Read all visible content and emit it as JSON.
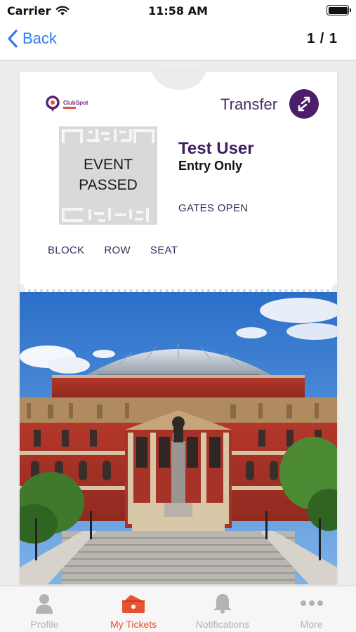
{
  "status_bar": {
    "carrier": "Carrier",
    "time": "11:58 AM"
  },
  "nav": {
    "back_label": "Back",
    "page_count": "1 / 1"
  },
  "ticket": {
    "logo_text": "ClubSpot",
    "transfer_label": "Transfer",
    "qr_overlay_line1": "EVENT",
    "qr_overlay_line2": "PASSED",
    "user_name": "Test User",
    "entry_type": "Entry Only",
    "gates_status": "GATES OPEN",
    "seat_labels": {
      "block": "BLOCK",
      "row": "ROW",
      "seat": "SEAT"
    }
  },
  "tabs": [
    {
      "label": "Profile",
      "icon": "person-icon",
      "active": false
    },
    {
      "label": "My Tickets",
      "icon": "ticket-icon",
      "active": true
    },
    {
      "label": "Notifications",
      "icon": "bell-icon",
      "active": false
    },
    {
      "label": "More",
      "icon": "ellipsis-icon",
      "active": false
    }
  ],
  "colors": {
    "accent_blue": "#2f7cf6",
    "brand_purple": "#4b1e69",
    "active_tab": "#e8522e",
    "inactive_tab": "#b3b3b3"
  }
}
